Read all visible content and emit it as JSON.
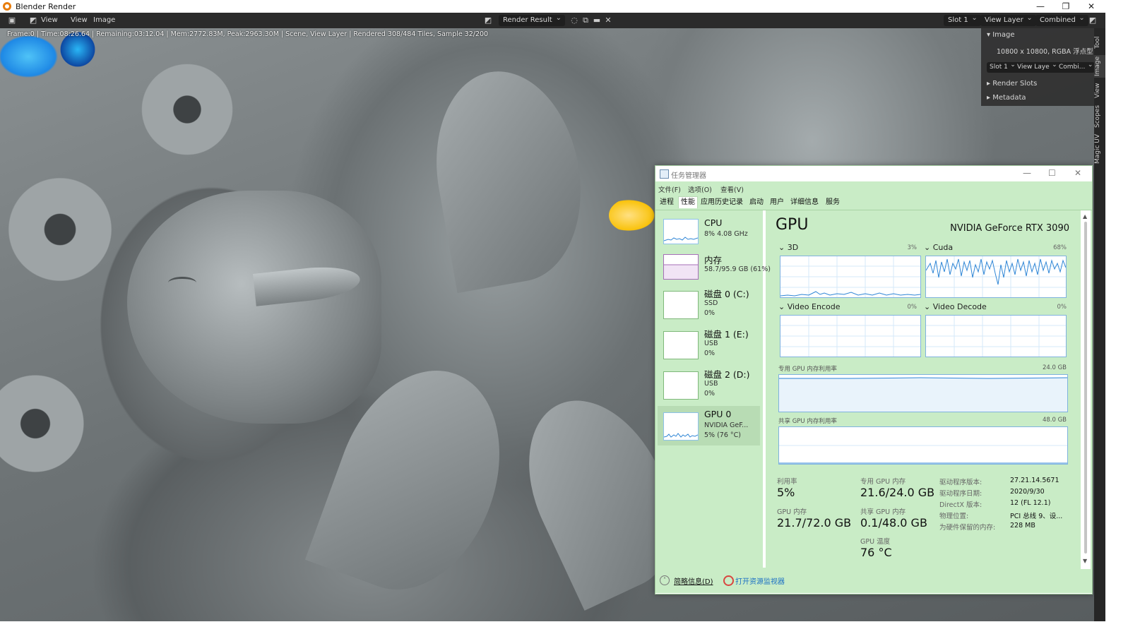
{
  "blender": {
    "window_title": "Blender Render",
    "menu": {
      "view": "View",
      "view2": "View",
      "image": "Image"
    },
    "image_name": "Render Result",
    "slot": "Slot 1",
    "view_layer": "View Layer",
    "pass": "Combined",
    "status": "Frame:0 | Time:08:26.64 | Remaining:03:12.04 | Mem:2772.83M, Peak:2963.30M | Scene, View Layer | Rendered 308/484 Tiles, Sample 32/200",
    "npanel": {
      "section_image": "Image",
      "resolution": "10800 x 10800,  RGBA 浮点型",
      "slot_dd": "Slot 1",
      "layer_dd": "View Laye",
      "pass_dd": "Combi...",
      "render_slots": "Render Slots",
      "metadata": "Metadata"
    },
    "side_tabs": [
      "Tool",
      "Image",
      "View",
      "Scopes",
      "Magic UV"
    ]
  },
  "taskmgr": {
    "title": "任务管理器",
    "menu": [
      "文件(F)",
      "选项(O)",
      "查看(V)"
    ],
    "tabs": [
      "进程",
      "性能",
      "应用历史记录",
      "启动",
      "用户",
      "详细信息",
      "服务"
    ],
    "active_tab": "性能",
    "left": [
      {
        "name": "CPU",
        "sub1": "8% 4.08 GHz",
        "sub2": ""
      },
      {
        "name": "内存",
        "sub1": "58.7/95.9 GB (61%)",
        "sub2": ""
      },
      {
        "name": "磁盘 0 (C:)",
        "sub1": "SSD",
        "sub2": "0%"
      },
      {
        "name": "磁盘 1 (E:)",
        "sub1": "USB",
        "sub2": "0%"
      },
      {
        "name": "磁盘 2 (D:)",
        "sub1": "USB",
        "sub2": "0%"
      },
      {
        "name": "GPU 0",
        "sub1": "NVIDIA GeF...",
        "sub2": "5% (76 °C)"
      }
    ],
    "gpu": {
      "title": "GPU",
      "model": "NVIDIA GeForce RTX 3090",
      "engines": [
        {
          "name": "3D",
          "pct": "3%"
        },
        {
          "name": "Cuda",
          "pct": "68%"
        },
        {
          "name": "Video Encode",
          "pct": "0%"
        },
        {
          "name": "Video Decode",
          "pct": "0%"
        }
      ],
      "dedicated_label": "专用 GPU 内存利用率",
      "dedicated_max": "24.0 GB",
      "shared_label": "共享 GPU 内存利用率",
      "shared_max": "48.0 GB",
      "stats": {
        "util_label": "利用率",
        "util": "5%",
        "ded_label": "专用 GPU 内存",
        "ded": "21.6/24.0 GB",
        "gpumem_label": "GPU 内存",
        "gpumem": "21.7/72.0 GB",
        "shared_label": "共享 GPU 内存",
        "shared": "0.1/48.0 GB",
        "temp_label": "GPU 温度",
        "temp": "76 °C"
      },
      "info": [
        {
          "k": "驱动程序版本:",
          "v": "27.21.14.5671"
        },
        {
          "k": "驱动程序日期:",
          "v": "2020/9/30"
        },
        {
          "k": "DirectX 版本:",
          "v": "12 (FL 12.1)"
        },
        {
          "k": "物理位置:",
          "v": "PCI 总线 9、设..."
        },
        {
          "k": "为硬件保留的内存:",
          "v": "228 MB"
        }
      ]
    },
    "footer": {
      "less": "简略信息(D)",
      "monitor": "打开资源监视器"
    }
  }
}
